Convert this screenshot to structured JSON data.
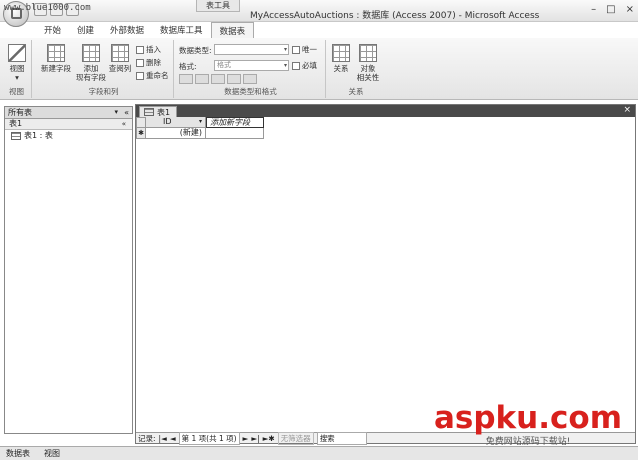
{
  "watermark_top": "www.blue1000.com",
  "title": {
    "context_tab": "表工具",
    "window_title": "MyAccessAutoAuctions : 数据库 (Access 2007) - Microsoft Access",
    "controls": [
      "–",
      "□",
      "×"
    ]
  },
  "tabs": [
    "开始",
    "创建",
    "外部数据",
    "数据库工具",
    "数据表"
  ],
  "active_tab": 4,
  "ribbon": {
    "views": {
      "label": "视图",
      "group_label": "视图"
    },
    "fields_columns": {
      "group_label": "字段和列",
      "new_field": "新建字段",
      "add_existing": [
        "添加",
        "现有字段"
      ],
      "lookup_column": "查阅列",
      "insert": "插入",
      "delete": "删除",
      "rename": "重命名"
    },
    "datatype_formatting": {
      "group_label": "数据类型和格式",
      "datatype_label": "数据类型:",
      "format_label": "格式:",
      "format_value": "格式",
      "unique": "唯一",
      "required": "必填"
    },
    "relationships": {
      "group_label": "关系",
      "relationships": "关系",
      "object_dependencies": [
        "对象",
        "相关性"
      ]
    }
  },
  "nav": {
    "header": "所有表",
    "collapse": "«",
    "group": "表1",
    "group_chevron": "«",
    "items": [
      "表1 : 表"
    ]
  },
  "document": {
    "tab": "表1",
    "close": "×",
    "columns": [
      "ID",
      "添加新字段"
    ],
    "new_row": "(新建)",
    "new_row_marker": "✱"
  },
  "record_nav": {
    "label": "记录:",
    "first": "|◄",
    "prev": "◄",
    "position": "第 1 项(共 1 项)",
    "next": "►",
    "last": "►|",
    "new": "►✱",
    "filter": "无筛选器",
    "search": "搜索"
  },
  "status": {
    "left": "数据表",
    "view": "视图"
  },
  "watermark": {
    "main": "aspku.com",
    "sub": "免费网站源码下载站!"
  }
}
